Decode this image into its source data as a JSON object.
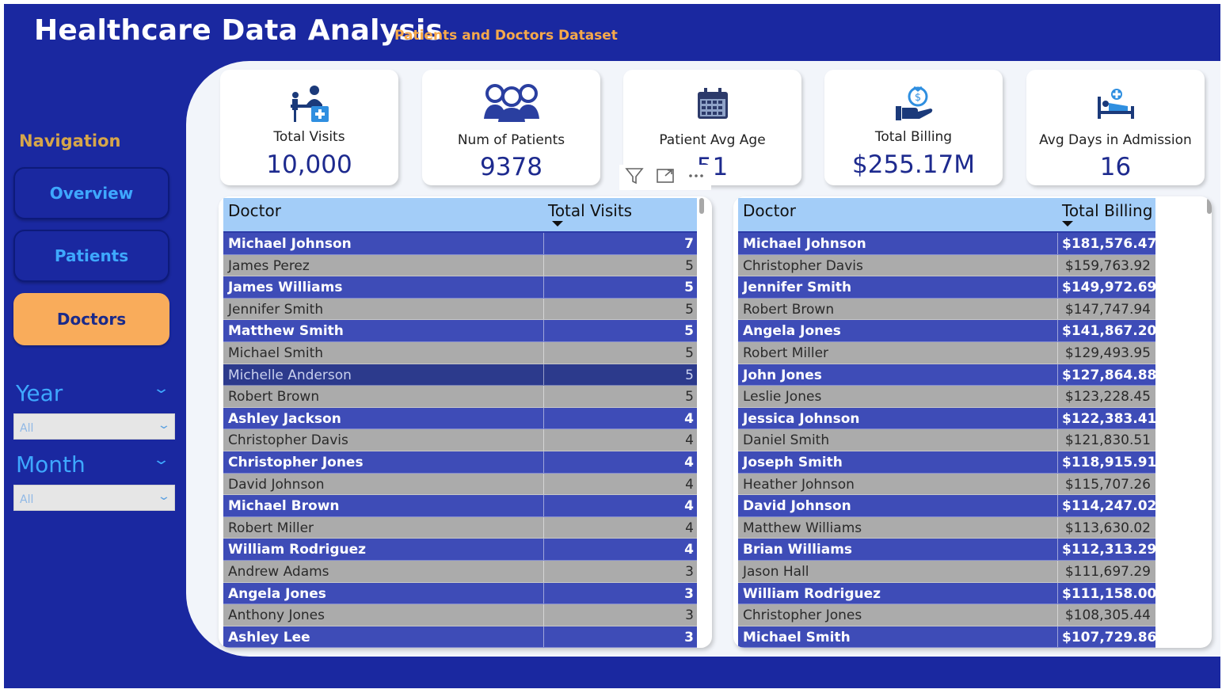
{
  "header": {
    "title": "Healthcare Data Analysis",
    "subtitle": "Patients and Doctors Dataset"
  },
  "nav": {
    "heading": "Navigation",
    "items": [
      {
        "label": "Overview",
        "active": false
      },
      {
        "label": "Patients",
        "active": false
      },
      {
        "label": "Doctors",
        "active": true
      }
    ]
  },
  "slicers": {
    "year": {
      "title": "Year",
      "value": "All"
    },
    "month": {
      "title": "Month",
      "value": "All"
    }
  },
  "kpis": [
    {
      "label": "Total Visits",
      "value": "10,000",
      "icon": "doctor-desk-icon"
    },
    {
      "label": "Num of Patients",
      "value": "9378",
      "icon": "group-people-icon"
    },
    {
      "label": "Patient Avg Age",
      "value": "51",
      "icon": "calendar-icon"
    },
    {
      "label": "Total Billing",
      "value": "$255.17M",
      "icon": "money-hand-icon"
    },
    {
      "label": "Avg Days in Admission",
      "value": "16",
      "icon": "hospital-bed-icon"
    }
  ],
  "visits_table": {
    "headers": [
      "Doctor",
      "Total Visits"
    ],
    "rows": [
      [
        "Michael Johnson",
        "7"
      ],
      [
        "James Perez",
        "5"
      ],
      [
        "James Williams",
        "5"
      ],
      [
        "Jennifer Smith",
        "5"
      ],
      [
        "Matthew Smith",
        "5"
      ],
      [
        "Michael Smith",
        "5"
      ],
      [
        "Michelle Anderson",
        "5"
      ],
      [
        "Robert Brown",
        "5"
      ],
      [
        "Ashley Jackson",
        "4"
      ],
      [
        "Christopher Davis",
        "4"
      ],
      [
        "Christopher Jones",
        "4"
      ],
      [
        "David Johnson",
        "4"
      ],
      [
        "Michael Brown",
        "4"
      ],
      [
        "Robert Miller",
        "4"
      ],
      [
        "William Rodriguez",
        "4"
      ],
      [
        "Andrew Adams",
        "3"
      ],
      [
        "Angela Jones",
        "3"
      ],
      [
        "Anthony Jones",
        "3"
      ],
      [
        "Ashley Lee",
        "3"
      ]
    ],
    "selected_row": "Michelle Anderson"
  },
  "billing_table": {
    "headers": [
      "Doctor",
      "Total Billing"
    ],
    "rows": [
      [
        "Michael Johnson",
        "$181,576.47"
      ],
      [
        "Christopher Davis",
        "$159,763.92"
      ],
      [
        "Jennifer Smith",
        "$149,972.69"
      ],
      [
        "Robert Brown",
        "$147,747.94"
      ],
      [
        "Angela Jones",
        "$141,867.20"
      ],
      [
        "Robert Miller",
        "$129,493.95"
      ],
      [
        "John Jones",
        "$127,864.88"
      ],
      [
        "Leslie Jones",
        "$123,228.45"
      ],
      [
        "Jessica Johnson",
        "$122,383.41"
      ],
      [
        "Daniel Smith",
        "$121,830.51"
      ],
      [
        "Joseph Smith",
        "$118,915.91"
      ],
      [
        "Heather Johnson",
        "$115,707.26"
      ],
      [
        "David Johnson",
        "$114,247.02"
      ],
      [
        "Matthew Williams",
        "$113,630.02"
      ],
      [
        "Brian Williams",
        "$112,313.29"
      ],
      [
        "Jason Hall",
        "$111,697.29"
      ],
      [
        "William Rodriguez",
        "$111,158.00"
      ],
      [
        "Christopher Jones",
        "$108,305.44"
      ],
      [
        "Michael Smith",
        "$107,729.86"
      ]
    ]
  },
  "visual_toolbar": [
    "filter-icon",
    "focus-mode-icon",
    "more-options-icon"
  ],
  "colors": {
    "background": "#1a28a0",
    "accent": "#f9ac5b",
    "row_dark": "#3e4cb7",
    "row_light": "#ababab",
    "header": "#a3cdf8"
  }
}
